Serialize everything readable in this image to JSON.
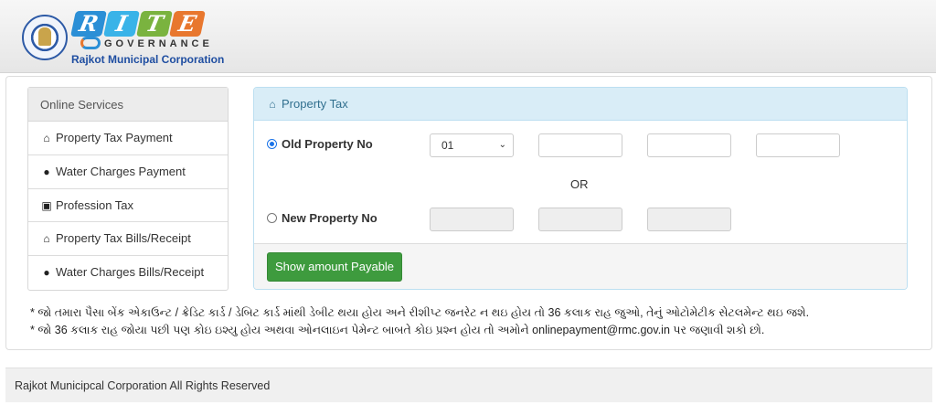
{
  "header": {
    "brand_letters": [
      "R",
      "I",
      "T",
      "E"
    ],
    "brand_sub": "GOVERNANCE",
    "org_name": "Rajkot Municipal Corporation"
  },
  "sidebar": {
    "heading": "Online Services",
    "items": [
      {
        "icon": "home-icon",
        "label": "Property Tax Payment"
      },
      {
        "icon": "water-drop-icon",
        "label": "Water Charges Payment"
      },
      {
        "icon": "briefcase-icon",
        "label": "Profession Tax"
      },
      {
        "icon": "home-icon",
        "label": "Property Tax Bills/Receipt"
      },
      {
        "icon": "water-drop-icon",
        "label": "Water Charges Bills/Receipt"
      }
    ]
  },
  "panel": {
    "title": "Property Tax",
    "old_property_label": "Old Property No",
    "old_property_selected": true,
    "zone_select_value": "01",
    "or_text": "OR",
    "new_property_label": "New Property No",
    "new_property_selected": false,
    "submit_label": "Show amount Payable"
  },
  "notes": [
    "* જો તમારા પૈસા બેંક એકાઉન્ટ / ક્રેડિટ કાર્ડ / ડેબિટ કાર્ડ માંથી ડેબીટ થયા હોય અને રીશીપ્ટ જનરેટ ન થઇ હોય તો 36 કલાક રાહ જુઓ, તેનું ઓટોમેટીક સેટલમેન્ટ થઇ જશે.",
    "* જો 36 કલાક રાહ જોયા પછી પણ કોઇ ઇશ્યુ હોય અથવા ઓનલાઇન પેમેન્ટ બાબતે કોઇ પ્રશ્ન હોય તો અમોને onlinepayment@rmc.gov.in પર જણાવી શકો છો."
  ],
  "footer": {
    "text": "Rajkot Municipcal Corporation All Rights Reserved"
  },
  "colors": {
    "panel_header_bg": "#d9edf7",
    "button_green": "#3e9b3e",
    "brand_blue": "#1f4ea1"
  }
}
